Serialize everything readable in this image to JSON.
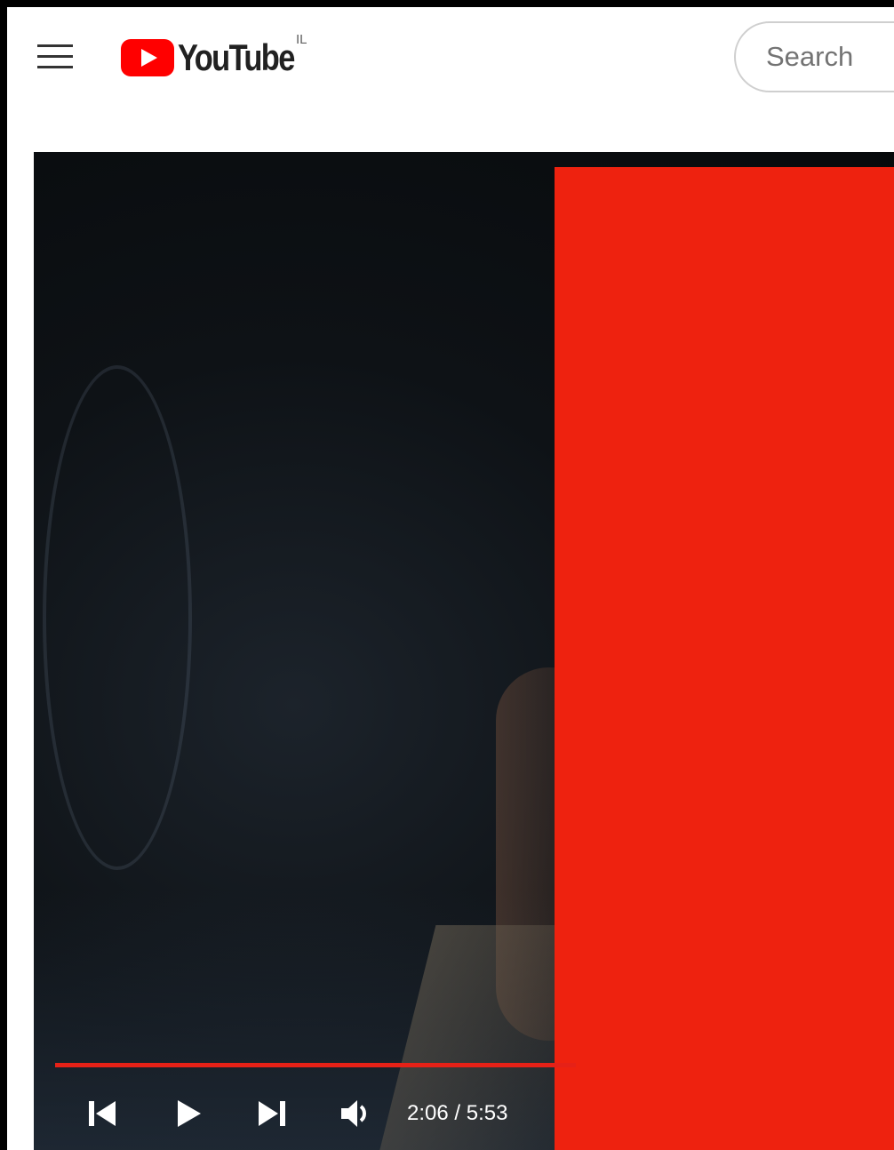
{
  "header": {
    "logo_text": "YouTube",
    "country_code": "IL",
    "search_placeholder": "Search"
  },
  "player": {
    "current_time": "2:06",
    "duration": "5:53",
    "time_display": "2:06 / 5:53",
    "progress_fraction": 0.357
  },
  "colors": {
    "brand_red": "#ff0000",
    "overlay_red": "#ee220f",
    "progress_red": "#e62117"
  },
  "icons": {
    "menu": "hamburger-icon",
    "logo": "youtube-play-icon",
    "previous": "skip-previous-icon",
    "play": "play-icon",
    "next": "skip-next-icon",
    "volume": "volume-icon"
  }
}
